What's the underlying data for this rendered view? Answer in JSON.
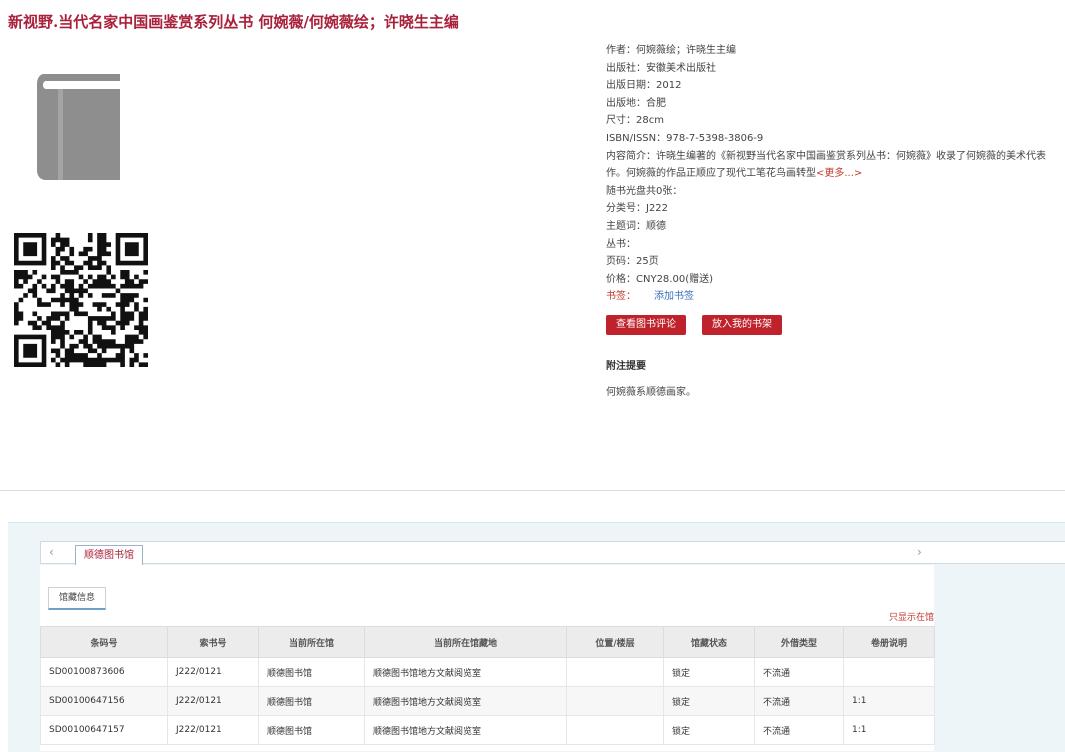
{
  "book": {
    "title": "新视野.当代名家中国画鉴赏系列丛书 何婉薇/何婉薇绘；许晓生主编"
  },
  "meta": {
    "author": "作者：何婉薇绘；许晓生主编",
    "publisher": "出版社：安徽美术出版社",
    "pub_date": "出版日期：2012",
    "pub_place": "出版地：合肥",
    "size": "尺寸：28cm",
    "isbn": "ISBN/ISSN：978-7-5398-3806-9",
    "summary": "内容简介：许晓生编著的《新视野当代名家中国画鉴赏系列丛书：何婉薇》收录了何婉薇的美术代表作。何婉薇的作品正顺应了现代工笔花鸟画转型",
    "more_label": "<更多...>",
    "cd": "随书光盘共0张：",
    "class_no": "分类号：J222",
    "subject": "主题词：顺德",
    "series": "丛书：",
    "pages": "页码：25页",
    "price": "价格：CNY28.00(赠送)",
    "bookmark_label": "书签：",
    "add_bookmark": "添加书签"
  },
  "buttons": {
    "review": "查看图书评论",
    "shelf": "放入我的书架"
  },
  "note": {
    "title": "附注提要",
    "text": "何婉薇系顺德画家。"
  },
  "library": {
    "tab": "顺德图书馆",
    "subtab": "馆藏信息",
    "only_show": "只显示在馆",
    "columns": [
      "条码号",
      "索书号",
      "当前所在馆",
      "当前所在馆藏地",
      "位置/楼层",
      "馆藏状态",
      "外借类型",
      "卷册说明"
    ],
    "rows": [
      [
        "SD00100873606",
        "J222/0121",
        "顺德图书馆",
        "顺德图书馆地方文献阅览室",
        "",
        "锁定",
        "不流通",
        ""
      ],
      [
        "SD00100647156",
        "J222/0121",
        "顺德图书馆",
        "顺德图书馆地方文献阅览室",
        "",
        "锁定",
        "不流通",
        "1:1"
      ],
      [
        "SD00100647157",
        "J222/0121",
        "顺德图书馆",
        "顺德图书馆地方文献阅览室",
        "",
        "锁定",
        "不流通",
        "1:1"
      ]
    ]
  },
  "icons": {
    "book": "book-icon",
    "qr": "qr-code",
    "prev": "chevron-left-icon",
    "next": "chevron-right-icon"
  },
  "colors": {
    "title": "#a8203a",
    "button": "#c0222b",
    "link": "#3b6fb6"
  }
}
